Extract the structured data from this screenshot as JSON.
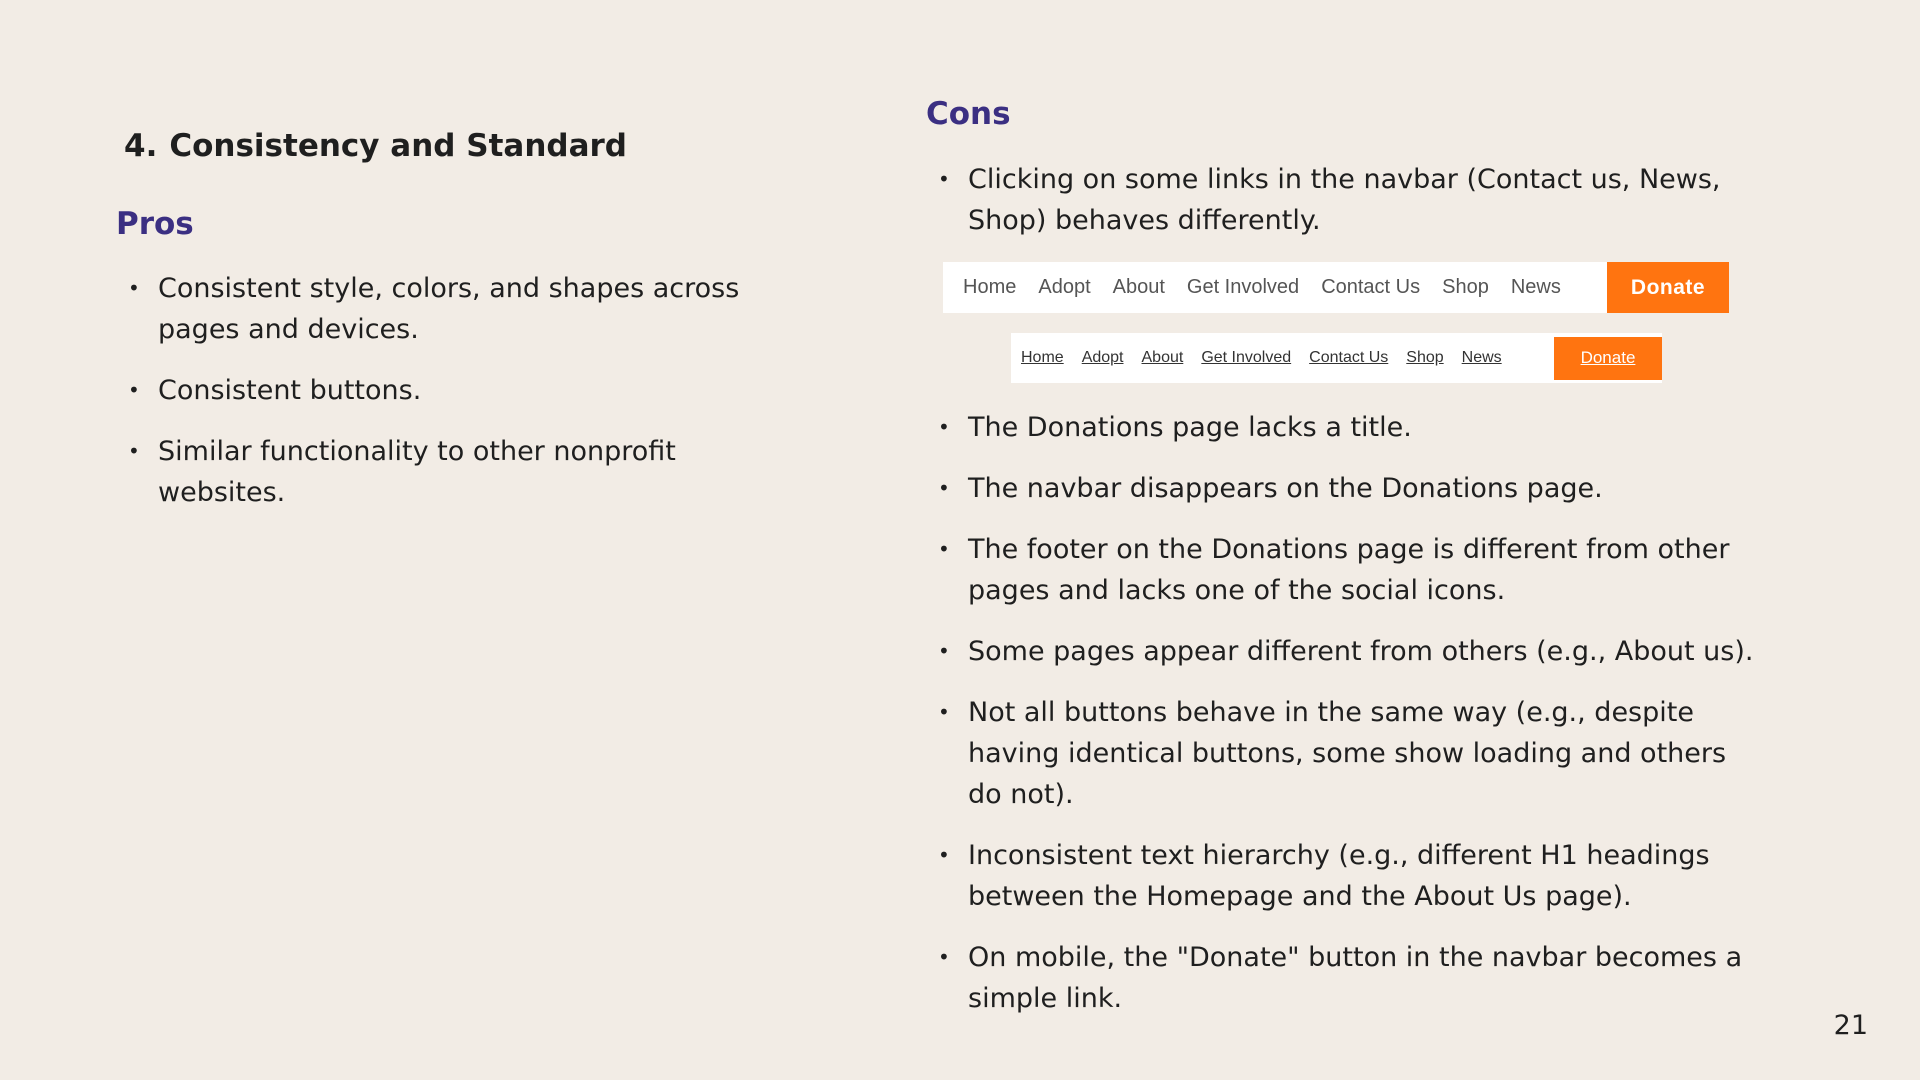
{
  "section": {
    "number": "4.",
    "title": "Consistency and Standard"
  },
  "pros": {
    "heading": "Pros",
    "items": [
      "Consistent style, colors, and shapes across pages and devices.",
      "Consistent buttons.",
      "Similar functionality to other nonprofit websites."
    ]
  },
  "cons": {
    "heading": "Cons",
    "items": [
      "Clicking on some links in the navbar (Contact us, News, Shop) behaves differently.",
      "The Donations page lacks a title.",
      "The navbar disappears on the Donations page.",
      "The footer on the Donations page is different from other pages and lacks one of the social icons.",
      "Some pages appear different from others (e.g., About us).",
      "Not all buttons behave in the same way (e.g., despite having identical buttons, some show loading and others do not).",
      "Inconsistent text hierarchy (e.g., different H1 headings between the Homepage and the About Us page).",
      "On mobile, the \"Donate\" button in the navbar becomes a simple link."
    ]
  },
  "navbar_example_1": {
    "links": [
      "Home",
      "Adopt",
      "About",
      "Get Involved",
      "Contact Us",
      "Shop",
      "News"
    ],
    "donate": "Donate"
  },
  "navbar_example_2": {
    "links": [
      "Home",
      "Adopt",
      "About",
      "Get Involved",
      "Contact Us",
      "Shop",
      "News"
    ],
    "donate": "Donate"
  },
  "colors": {
    "background": "#f2ece5",
    "heading_accent": "#3b2f82",
    "donate_orange": "#ff7410"
  },
  "bullet_glyph": "•",
  "page_number": "21"
}
